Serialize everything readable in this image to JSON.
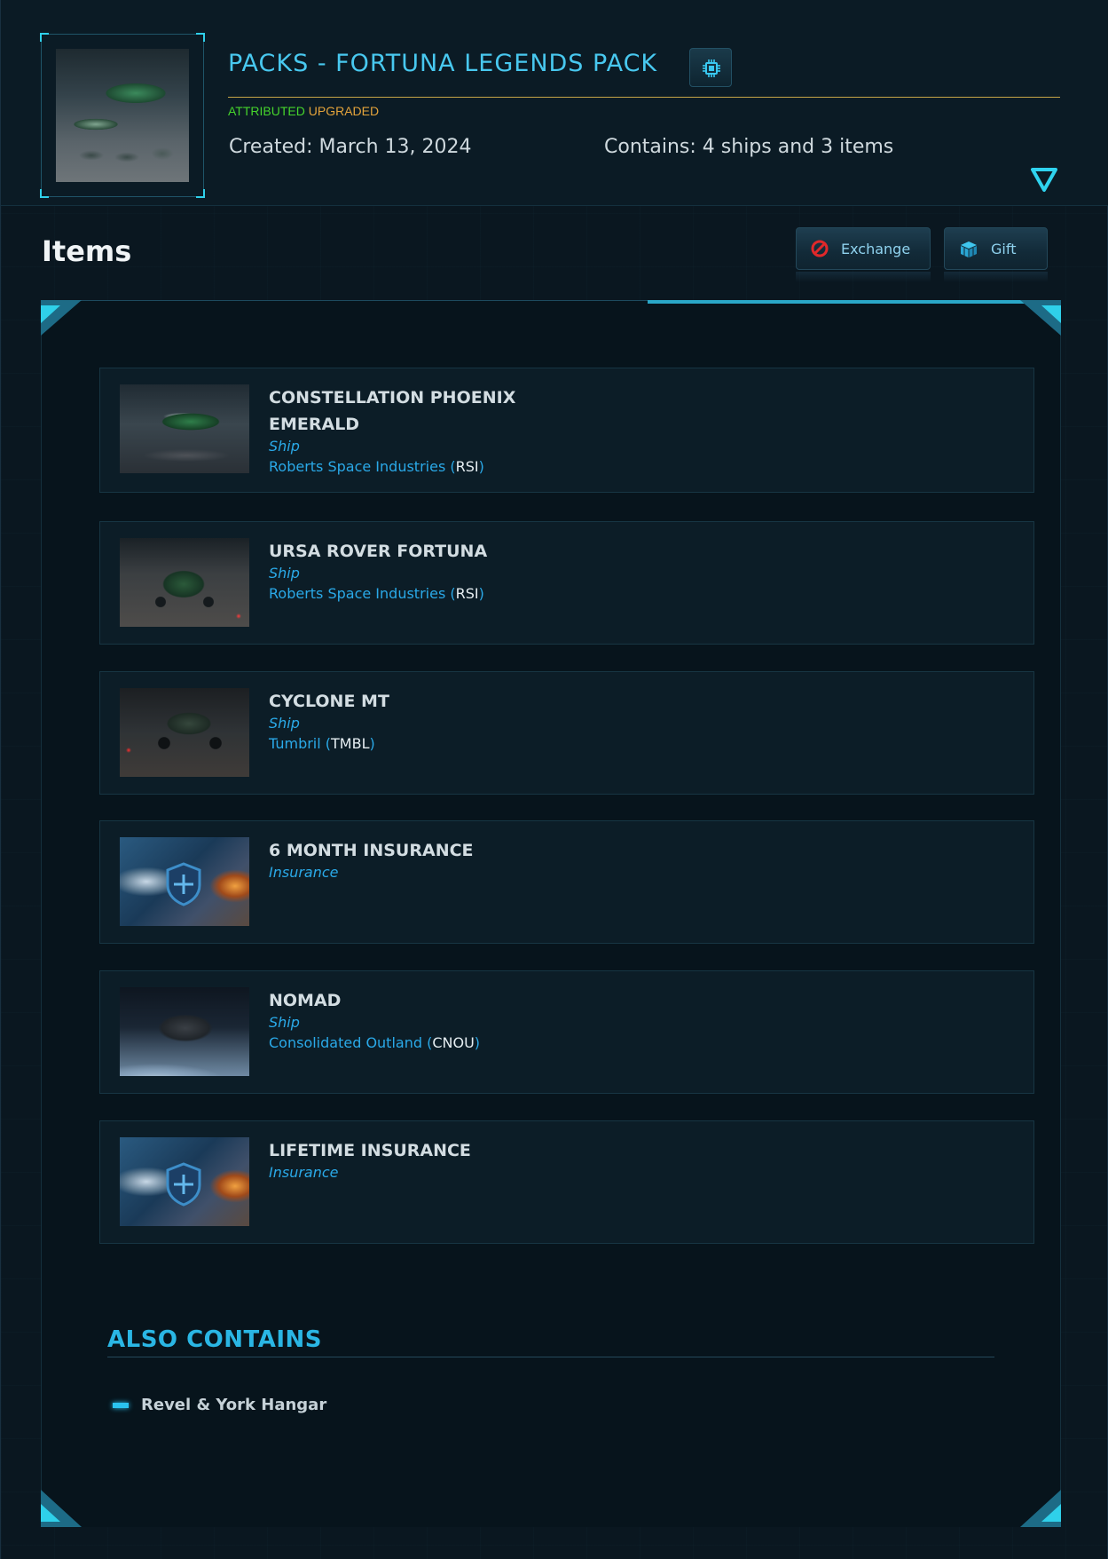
{
  "header": {
    "title": "PACKS - FORTUNA LEGENDS PACK",
    "status_attributed": "ATTRIBUTED",
    "status_upgraded": "UPGRADED",
    "created": "Created: March 13, 2024",
    "contains": "Contains: 4 ships and 3 items",
    "title_icon": "chip-icon",
    "toggle_icon": "triangle-down-icon"
  },
  "items_section": {
    "heading": "Items",
    "exchange_label": "Exchange",
    "gift_label": "Gift"
  },
  "items": [
    {
      "name": "CONSTELLATION PHOENIX EMERALD",
      "type": "Ship",
      "manufacturer": "Roberts Space Industries",
      "code": "RSI"
    },
    {
      "name": "URSA ROVER FORTUNA",
      "type": "Ship",
      "manufacturer": "Roberts Space Industries",
      "code": "RSI"
    },
    {
      "name": "CYCLONE MT",
      "type": "Ship",
      "manufacturer": "Tumbril",
      "code": "TMBL"
    },
    {
      "name": "6 MONTH INSURANCE",
      "type": "Insurance"
    },
    {
      "name": "NOMAD",
      "type": "Ship",
      "manufacturer": "Consolidated Outland",
      "code": "CNOU"
    },
    {
      "name": "LIFETIME INSURANCE",
      "type": "Insurance"
    }
  ],
  "also_contains": {
    "heading": "ALSO CONTAINS",
    "items": [
      "Revel & York Hangar"
    ]
  },
  "colors": {
    "accent": "#48c8ef",
    "attributed": "#46d42c",
    "upgraded": "#e3a33b",
    "link": "#2aa9e8",
    "exchange_icon": "#e0282a"
  }
}
